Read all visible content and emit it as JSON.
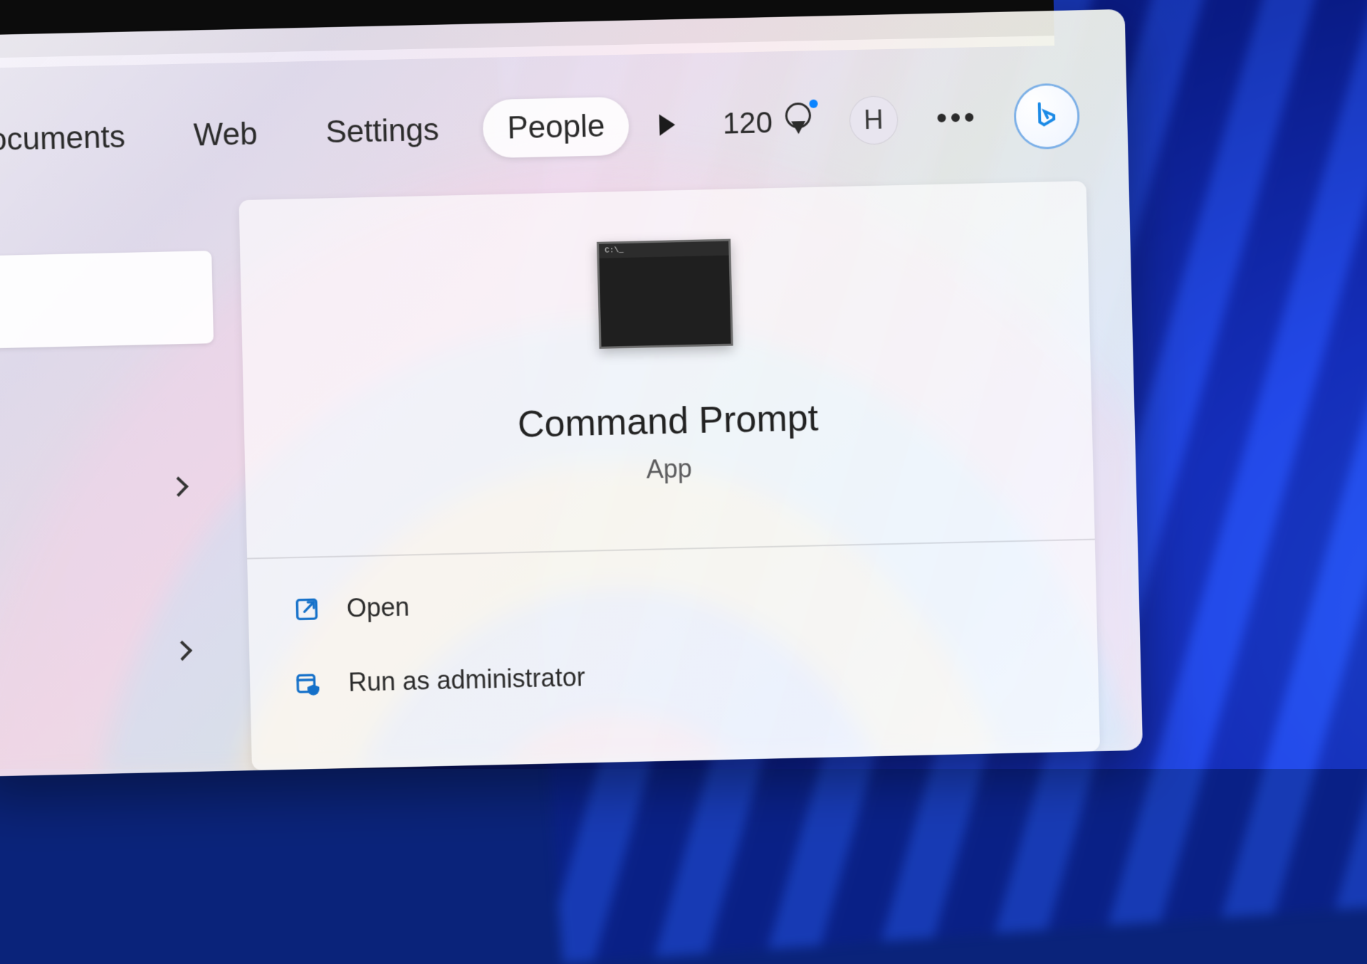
{
  "header": {
    "tabs": [
      {
        "label": "Documents",
        "active": false
      },
      {
        "label": "Web",
        "active": false
      },
      {
        "label": "Settings",
        "active": false
      },
      {
        "label": "People",
        "active": true
      }
    ],
    "rewards_points": "120",
    "avatar_initial": "H"
  },
  "result": {
    "title": "Command Prompt",
    "subtype": "App",
    "icon_prompt_text": "C:\\_"
  },
  "actions": [
    {
      "id": "open",
      "label": "Open",
      "icon": "open-external-icon"
    },
    {
      "id": "admin",
      "label": "Run as administrator",
      "icon": "run-admin-icon"
    }
  ]
}
